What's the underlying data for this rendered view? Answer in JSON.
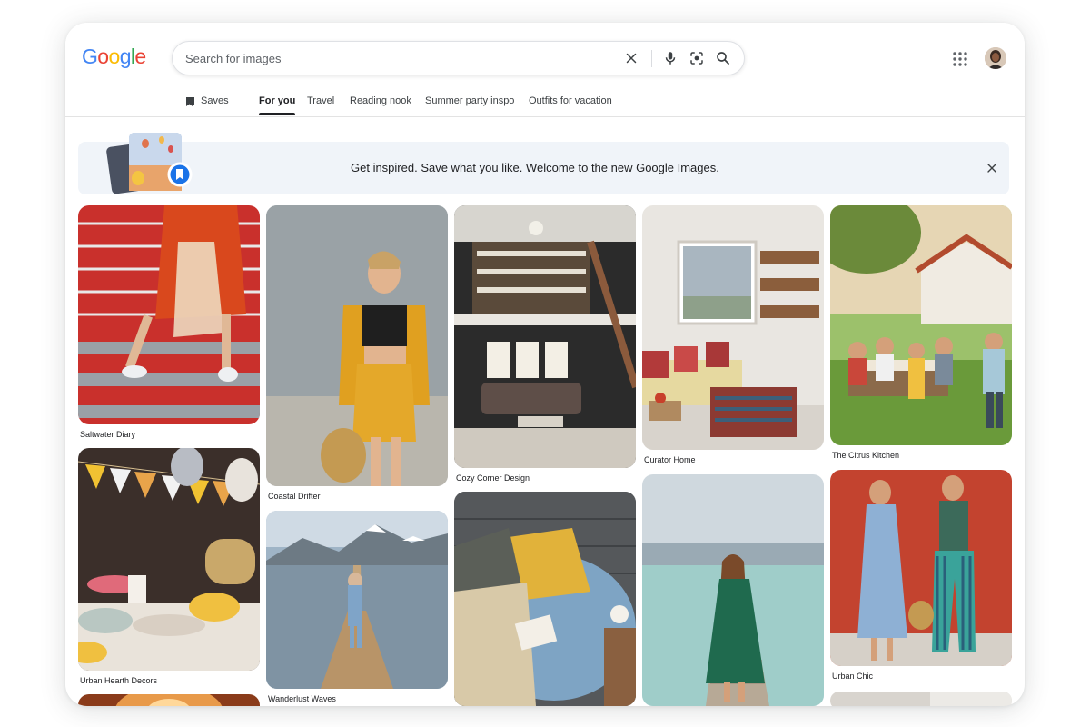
{
  "logo": {
    "letters": [
      "G",
      "o",
      "o",
      "g",
      "l",
      "e"
    ],
    "colors": [
      "#4285F4",
      "#EA4335",
      "#FBBC05",
      "#4285F4",
      "#34A853",
      "#EA4335"
    ]
  },
  "search": {
    "placeholder": "Search for images",
    "value": ""
  },
  "header_icons": [
    "clear-icon",
    "mic-icon",
    "lens-icon",
    "search-icon",
    "apps-grid-icon"
  ],
  "tabs": {
    "saves": "Saves",
    "items": [
      "For you",
      "Travel",
      "Reading nook",
      "Summer party inspo",
      "Outfits for vacation"
    ],
    "active": "For you"
  },
  "banner": {
    "text": "Get inspired. Save what you like. Welcome to the new Google Images."
  },
  "cards": [
    {
      "caption": "Saltwater Diary"
    },
    {
      "caption": "Urban Hearth Decors"
    },
    {
      "caption": ""
    },
    {
      "caption": "Coastal Drifter"
    },
    {
      "caption": "Wanderlust Waves"
    },
    {
      "caption": "Cozy Corner Design"
    },
    {
      "caption": ""
    },
    {
      "caption": "Curator Home"
    },
    {
      "caption": ""
    },
    {
      "caption": "The Citrus Kitchen"
    },
    {
      "caption": "Urban Chic"
    },
    {
      "caption": ""
    }
  ],
  "accent_color": "#1a73e8"
}
